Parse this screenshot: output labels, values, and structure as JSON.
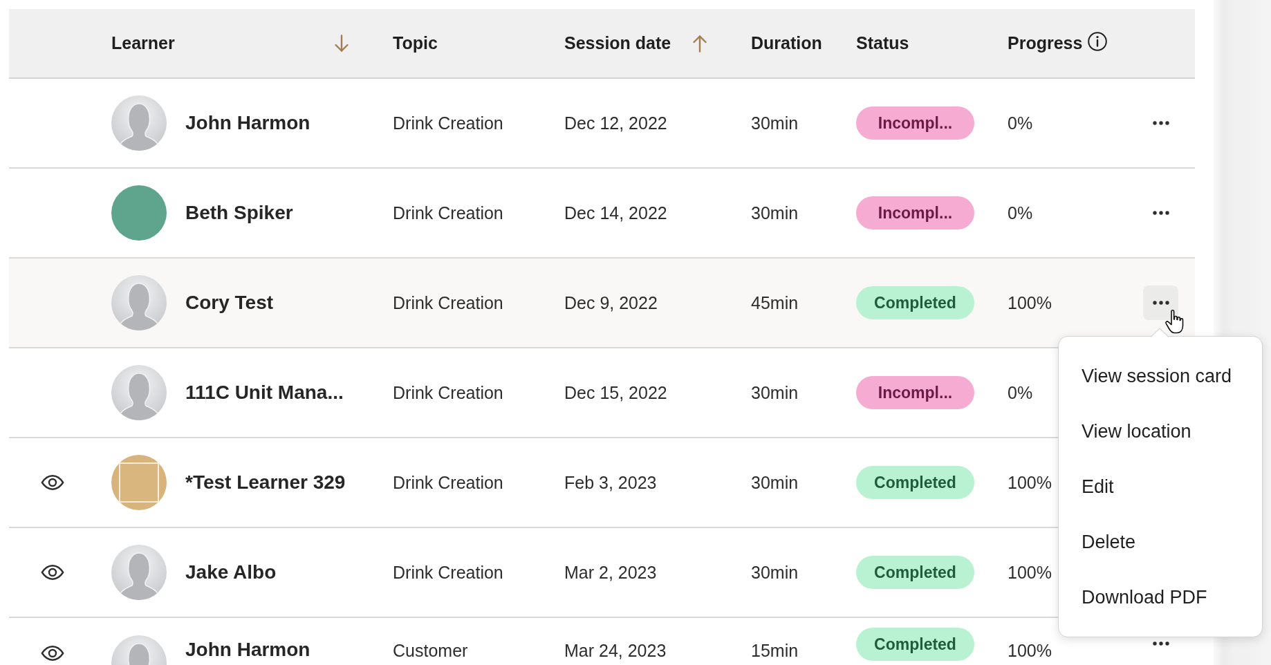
{
  "table": {
    "columns": [
      {
        "label": "Learner",
        "sort": {
          "kind": "desc"
        },
        "info": false
      },
      {
        "label": "Topic",
        "info": false
      },
      {
        "label": "Session date",
        "sort": {
          "kind": "asc"
        },
        "info": false
      },
      {
        "label": "Duration",
        "info": false
      },
      {
        "label": "Status",
        "info": false
      },
      {
        "label": "Progress",
        "info": true
      }
    ],
    "rows": [
      {
        "eye_icon": false,
        "avatar": {
          "kind": "silhouette"
        },
        "learner": "John Harmon",
        "topic": "Drink Creation",
        "session_date": "Dec 12, 2022",
        "duration": "30min",
        "status": {
          "label": "Incompl...",
          "kind": "incomplete"
        },
        "progress": "0%"
      },
      {
        "eye_icon": false,
        "avatar": {
          "kind": "photo"
        },
        "learner": "Beth Spiker",
        "topic": "Drink Creation",
        "session_date": "Dec 14, 2022",
        "duration": "30min",
        "status": {
          "label": "Incompl...",
          "kind": "incomplete"
        },
        "progress": "0%"
      },
      {
        "eye_icon": false,
        "avatar": {
          "kind": "silhouette"
        },
        "learner": "Cory Test",
        "topic": "Drink Creation",
        "session_date": "Dec 9, 2022",
        "duration": "45min",
        "status": {
          "label": "Completed",
          "kind": "completed"
        },
        "progress": "100%",
        "menu": {
          "items": [
            "View session card",
            "View location",
            "Edit",
            "Delete",
            "Download PDF"
          ]
        }
      },
      {
        "eye_icon": false,
        "avatar": {
          "kind": "silhouette"
        },
        "learner": "111C Unit Mana...",
        "topic": "Drink Creation",
        "session_date": "Dec 15, 2022",
        "duration": "30min",
        "status": {
          "label": "Incompl...",
          "kind": "incomplete"
        },
        "progress": "0%"
      },
      {
        "eye_icon": true,
        "avatar": {
          "kind": "logo"
        },
        "learner": "*Test Learner 329",
        "topic": "Drink Creation",
        "session_date": "Feb 3, 2023",
        "duration": "30min",
        "status": {
          "label": "Completed",
          "kind": "completed"
        },
        "progress": "100%"
      },
      {
        "eye_icon": true,
        "avatar": {
          "kind": "silhouette"
        },
        "learner": "Jake Albo",
        "topic": "Drink Creation",
        "session_date": "Mar 2, 2023",
        "duration": "30min",
        "status": {
          "label": "Completed",
          "kind": "completed"
        },
        "progress": "100%"
      },
      {
        "eye_icon": true,
        "avatar": {
          "kind": "silhouette"
        },
        "learner": "John Harmon",
        "topic": "Customer",
        "session_date": "Mar 24, 2023",
        "duration": "15min",
        "status": {
          "label": "Completed",
          "kind": "completed"
        },
        "progress": "100%"
      }
    ]
  }
}
